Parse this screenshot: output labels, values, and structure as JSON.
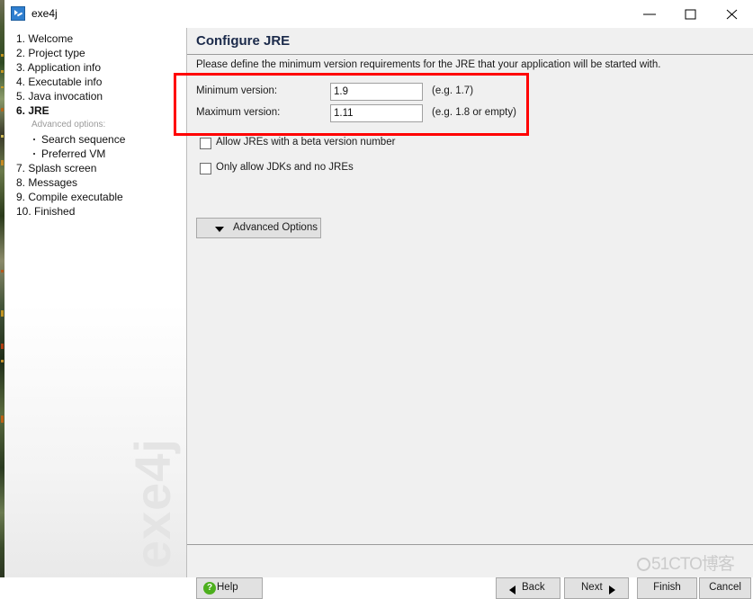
{
  "window": {
    "title": "exe4j",
    "icon": "app-icon",
    "controls": {
      "minimize": "minimize-icon",
      "maximize": "maximize-icon",
      "close": "close-icon"
    }
  },
  "sidebar": {
    "items": [
      {
        "label": "1. Welcome",
        "active": false
      },
      {
        "label": "2. Project type",
        "active": false
      },
      {
        "label": "3. Application info",
        "active": false
      },
      {
        "label": "4. Executable info",
        "active": false
      },
      {
        "label": "5. Java invocation",
        "active": false
      },
      {
        "label": "6. JRE",
        "active": true
      }
    ],
    "sub_header": "Advanced options:",
    "sub_items": [
      {
        "label": "Search sequence"
      },
      {
        "label": "Preferred VM"
      }
    ],
    "items_after": [
      {
        "label": "7. Splash screen",
        "active": false
      },
      {
        "label": "8. Messages",
        "active": false
      },
      {
        "label": "9. Compile executable",
        "active": false
      },
      {
        "label": "10. Finished",
        "active": false
      }
    ],
    "watermark": "exe4j"
  },
  "main": {
    "title": "Configure JRE",
    "description": "Please define the minimum version requirements for the JRE that your application will be started with.",
    "fields": [
      {
        "label": "Minimum version:",
        "value": "1.9",
        "placeholder": "",
        "hint": "(e.g. 1.7)"
      },
      {
        "label": "Maximum version:",
        "value": "1.11",
        "placeholder": "",
        "hint": "(e.g. 1.8 or empty)"
      }
    ],
    "checkboxes": [
      {
        "label": "Allow JREs with a beta version number",
        "checked": false
      },
      {
        "label": "Only allow JDKs and no JREs",
        "checked": false
      }
    ],
    "advanced_button": "Advanced Options"
  },
  "footer": {
    "help": "Help",
    "back": "Back",
    "next": "Next",
    "finish": "Finish",
    "cancel": "Cancel"
  },
  "watermark": {
    "cto": "51CTO博客"
  },
  "colors": {
    "annotation": "#ff0000",
    "accent": "#2f7fd0",
    "help_green": "#4caf1d",
    "title_blue": "#1b2a4a",
    "panel_bg": "#f0f0f0"
  }
}
